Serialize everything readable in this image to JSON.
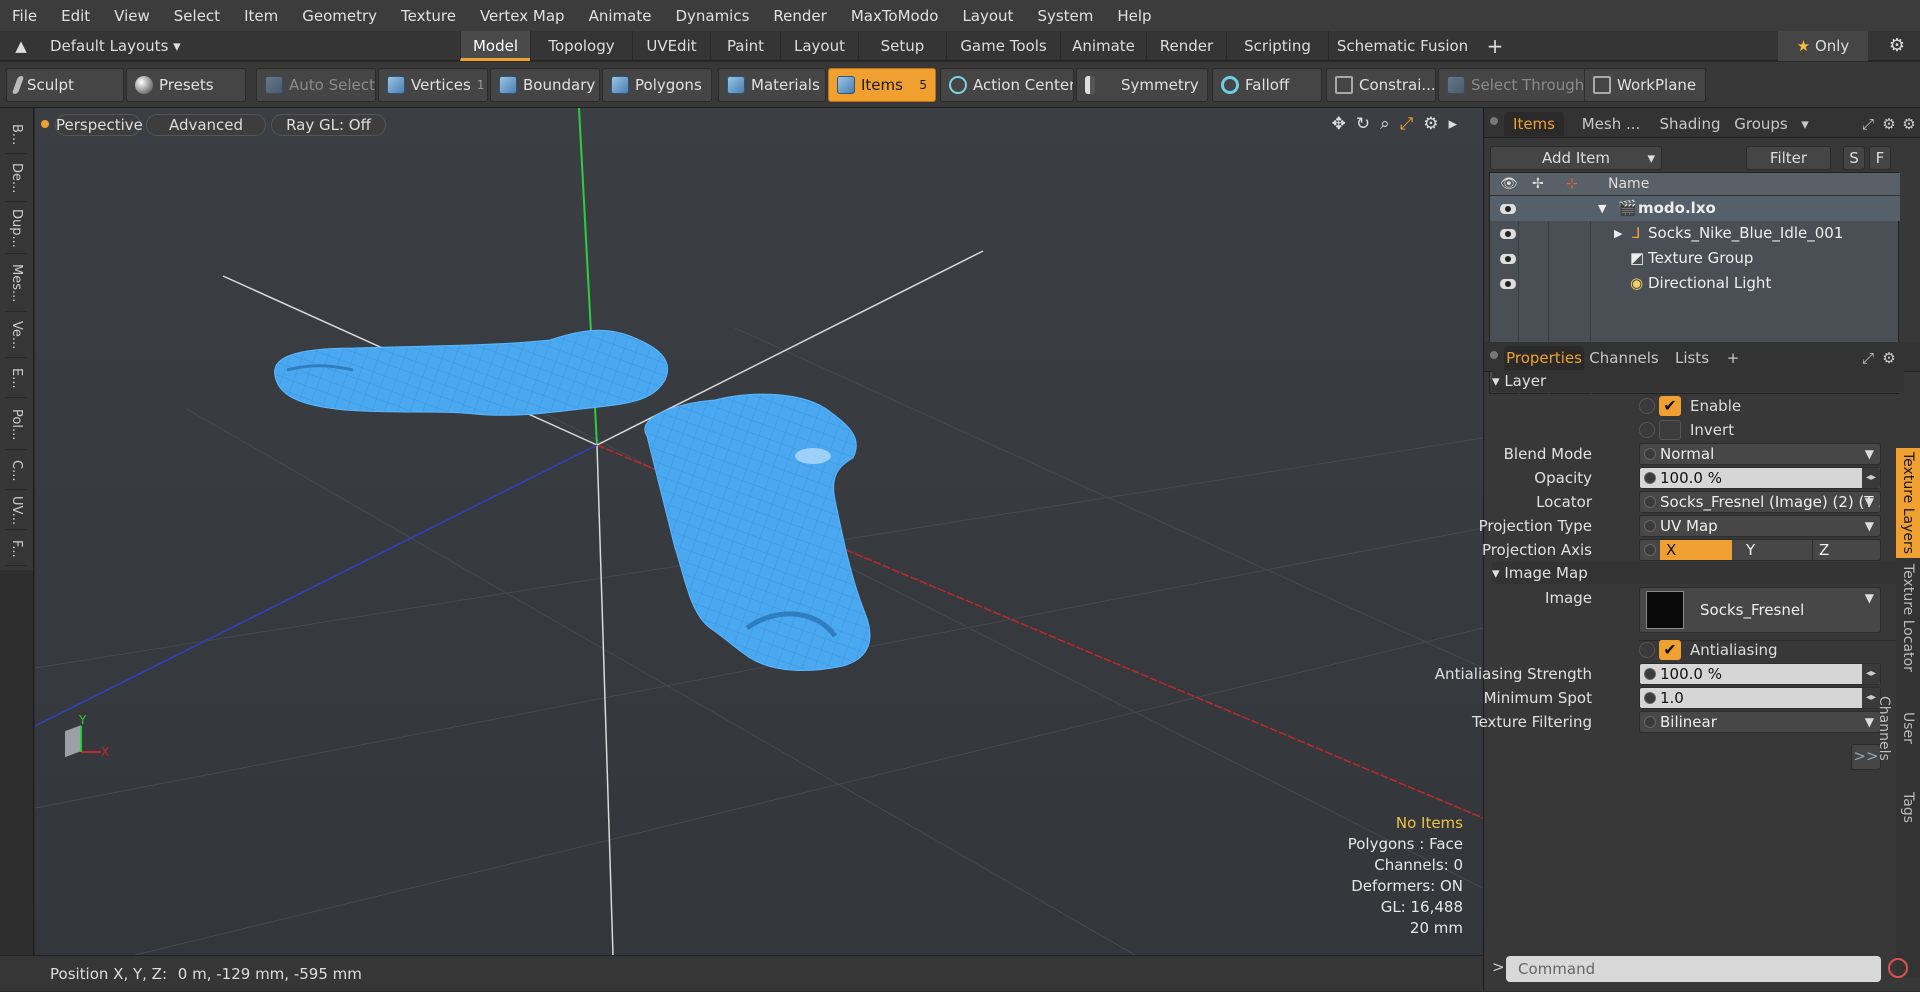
{
  "menu": [
    "File",
    "Edit",
    "View",
    "Select",
    "Item",
    "Geometry",
    "Texture",
    "Vertex Map",
    "Animate",
    "Dynamics",
    "Render",
    "MaxToModo",
    "Layout",
    "System",
    "Help"
  ],
  "layoutbar": {
    "layout_name": "Default Layouts",
    "tabs": [
      "Model",
      "Topology",
      "UVEdit",
      "Paint",
      "Layout",
      "Setup",
      "Game Tools",
      "Animate",
      "Render",
      "Scripting",
      "Schematic Fusion"
    ],
    "active_tab": "Model",
    "add_label": "+",
    "only_label": "Only"
  },
  "toolbar": {
    "sculpt": "Sculpt",
    "presets": "Presets",
    "auto_select": "Auto Select",
    "vertices": "Vertices",
    "vertices_count": "1",
    "boundary": "Boundary",
    "polygons": "Polygons",
    "materials": "Materials",
    "items": "Items",
    "items_count": "5",
    "action_center": "Action Center",
    "symmetry": "Symmetry",
    "falloff": "Falloff",
    "constraints": "Constrai...",
    "select_through": "Select Through",
    "workplane": "WorkPlane"
  },
  "left_tabs": [
    "B...",
    "De...",
    "Dup...",
    "Mes...",
    "Ve...",
    "E...",
    "Pol...",
    "C...",
    "UV...",
    "F..."
  ],
  "viewport": {
    "view": "Perspective",
    "advanced": "Advanced",
    "raygl": "Ray GL: Off",
    "info": {
      "items": "No Items",
      "polygons": "Polygons : Face",
      "channels": "Channels: 0",
      "deformers": "Deformers: ON",
      "gl": "GL: 16,488",
      "scale": "20 mm"
    },
    "axis_y": "Y",
    "axis_x": "X"
  },
  "status": {
    "position_label": "Position X, Y, Z:",
    "position_value": "0 m, -129 mm, -595 mm"
  },
  "items_panel": {
    "tabs": [
      "Items",
      "Mesh ...",
      "Shading",
      "Groups"
    ],
    "active_tab": "Items",
    "add_item": "Add Item",
    "filter_items": "Filter Items",
    "s_btn": "S",
    "f_btn": "F",
    "col_name": "Name",
    "rows": [
      {
        "name": "modo.lxo"
      },
      {
        "name": "Socks_Nike_Blue_Idle_001"
      },
      {
        "name": "Texture Group"
      },
      {
        "name": "Directional Light"
      }
    ]
  },
  "properties": {
    "tabs": [
      "Properties",
      "Channels",
      "Lists"
    ],
    "active_tab": "Properties",
    "add_tab": "+",
    "section_layer": "Layer",
    "enable": "Enable",
    "invert": "Invert",
    "blend_mode_label": "Blend Mode",
    "blend_mode": "Normal",
    "opacity_label": "Opacity",
    "opacity": "100.0 %",
    "locator_label": "Locator",
    "locator": "Socks_Fresnel (Image) (2) (T ...",
    "projection_type_label": "Projection Type",
    "projection_type": "UV Map",
    "projection_axis_label": "Projection Axis",
    "axis_x": "X",
    "axis_y": "Y",
    "axis_z": "Z",
    "section_image": "Image Map",
    "image_label": "Image",
    "image": "Socks_Fresnel",
    "antialiasing": "Antialiasing",
    "aa_strength_label": "Antialiasing Strength",
    "aa_strength": "100.0 %",
    "min_spot_label": "Minimum Spot",
    "min_spot": "1.0",
    "tex_filter_label": "Texture Filtering",
    "tex_filter": "Bilinear",
    "more": ">>"
  },
  "side_tabs": [
    "Texture Layers",
    "Texture Locator",
    "User Channels",
    "Tags"
  ],
  "command": {
    "placeholder": "Command",
    "prompt": ">"
  },
  "colors": {
    "accent": "#f0a030",
    "sock": "#4aa8f0",
    "viewport_bg": "#3b3f43"
  }
}
